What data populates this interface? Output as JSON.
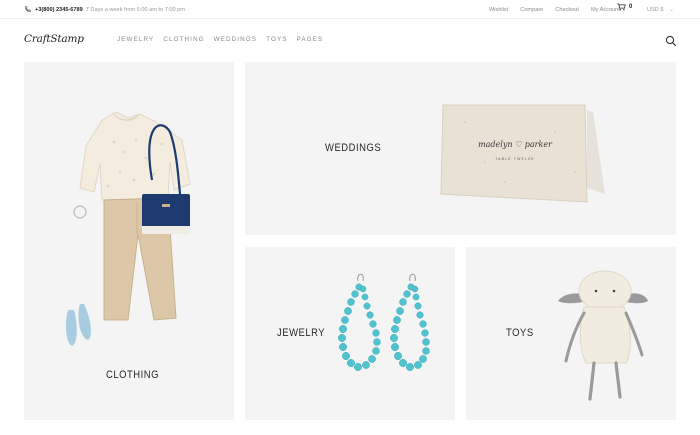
{
  "topbar": {
    "phone_number": "+3(800) 2345-6789",
    "hours": "7 Days a week from 6:00 am to 7:00 pm",
    "links": [
      "Wishlist",
      "Compare",
      "Checkout",
      "My Account"
    ],
    "cart_count": "0",
    "currency": "USD $"
  },
  "header": {
    "logo": "CraftStamp",
    "nav": [
      "JEWELRY",
      "CLOTHING",
      "WEDDINGS",
      "TOYS",
      "PAGES"
    ]
  },
  "tiles": {
    "clothing": "CLOTHING",
    "weddings": "WEDDINGS",
    "jewelry": "JEWELRY",
    "toys": "TOYS"
  },
  "wedding_card": {
    "script": "madelyn ♡ parker",
    "subtitle": "TABLE TWELVE"
  },
  "colors": {
    "tile_bg": "#f4f4f4",
    "bag_blue": "#1f3a6e",
    "bead_teal": "#4fc3cf",
    "shoe_blue": "#a9cde0"
  }
}
